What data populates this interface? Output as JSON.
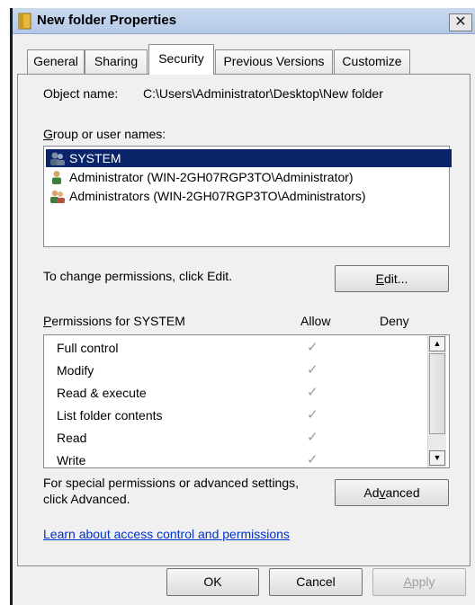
{
  "window": {
    "title": "New folder Properties",
    "close_glyph": "✕"
  },
  "tabs": [
    {
      "label": "General",
      "active": false
    },
    {
      "label": "Sharing",
      "active": false
    },
    {
      "label": "Security",
      "active": true
    },
    {
      "label": "Previous Versions",
      "active": false
    },
    {
      "label": "Customize",
      "active": false
    }
  ],
  "security": {
    "object_name_label": "Object name:",
    "object_name_value": "C:\\Users\\Administrator\\Desktop\\New folder",
    "group_label_accel": "G",
    "group_label_rest": "roup or user names:",
    "users": [
      {
        "name": "SYSTEM",
        "icon": "system-users-icon",
        "selected": true
      },
      {
        "name": "Administrator (WIN-2GH07RGP3TO\\Administrator)",
        "icon": "user-icon",
        "selected": false
      },
      {
        "name": "Administrators (WIN-2GH07RGP3TO\\Administrators)",
        "icon": "group-icon",
        "selected": false
      }
    ],
    "change_text": "To change permissions, click Edit.",
    "edit_accel": "E",
    "edit_rest": "dit...",
    "perms_label_accel": "P",
    "perms_label_rest": "ermissions for SYSTEM",
    "allow_header": "Allow",
    "deny_header": "Deny",
    "permissions": [
      {
        "name": "Full control",
        "allow": "✓"
      },
      {
        "name": "Modify",
        "allow": "✓"
      },
      {
        "name": "Read & execute",
        "allow": "✓"
      },
      {
        "name": "List folder contents",
        "allow": "✓"
      },
      {
        "name": "Read",
        "allow": "✓"
      },
      {
        "name": "Write",
        "allow": "✓"
      }
    ],
    "special_text_line1": "For special permissions or advanced settings,",
    "special_text_line2": "click Advanced.",
    "advanced_pre": "Ad",
    "advanced_accel": "v",
    "advanced_post": "anced",
    "learn_link": "Learn about access control and permissions"
  },
  "footer": {
    "ok": "OK",
    "cancel": "Cancel",
    "apply_accel": "A",
    "apply_rest": "pply"
  },
  "colors": {
    "selection": "#0a246a",
    "link": "#0033cc",
    "check": "#9a9a9a"
  }
}
